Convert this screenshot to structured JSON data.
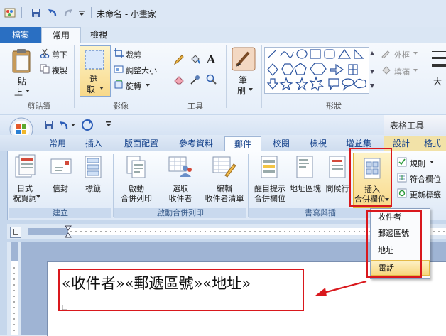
{
  "paint": {
    "title": "未命名 - 小畫家",
    "tabs": [
      {
        "label": "檔案"
      },
      {
        "label": "常用"
      },
      {
        "label": "檢視"
      }
    ],
    "clipboard": {
      "paste": "貼",
      "paste_sub": "上",
      "cut": "剪下",
      "copy": "複製",
      "group": "剪貼簿"
    },
    "image": {
      "select": "選",
      "select_sub": "取",
      "crop": "裁剪",
      "resize": "調整大小",
      "rotate": "旋轉",
      "group": "影像"
    },
    "tools": {
      "group": "工具",
      "text_tool": "A"
    },
    "brush": {
      "label": "筆",
      "label_sub": "刷"
    },
    "shapes": {
      "group": "形狀",
      "outline": "外框",
      "fill": "填滿"
    },
    "size_partial": "大"
  },
  "word": {
    "title_right": "表格工具",
    "tabs": [
      {
        "label": "常用"
      },
      {
        "label": "插入"
      },
      {
        "label": "版面配置"
      },
      {
        "label": "參考資料"
      },
      {
        "label": "郵件"
      },
      {
        "label": "校閱"
      },
      {
        "label": "檢視"
      },
      {
        "label": "增益集"
      },
      {
        "label": "設計"
      },
      {
        "label": "格式"
      }
    ],
    "create_group": {
      "label": "建立",
      "chinese_envelope": "日式",
      "chinese_envelope_sub": "祝賀詞",
      "envelopes": "信封",
      "labels": "標籤"
    },
    "start_group": {
      "label": "啟動合併列印",
      "start": "啟動",
      "start_sub": "合併列印",
      "select": "選取",
      "select_sub": "收件者",
      "edit": "編輯",
      "edit_sub": "收件者清單"
    },
    "write_group": {
      "label": "書寫與插",
      "highlight": "醒目提示",
      "highlight_sub": "合併欄位",
      "address_block": "地址區塊",
      "greeting": "問候行",
      "insert": "插入",
      "insert_sub": "合併欄位",
      "rules": "規則",
      "match": "符合欄位",
      "update": "更新標籤"
    },
    "dropdown": [
      {
        "label": "收件者"
      },
      {
        "label": "郵遞區號"
      },
      {
        "label": "地址"
      },
      {
        "label": "電話"
      }
    ],
    "document_text": "«收件者»«郵遞區號»«地址»"
  }
}
